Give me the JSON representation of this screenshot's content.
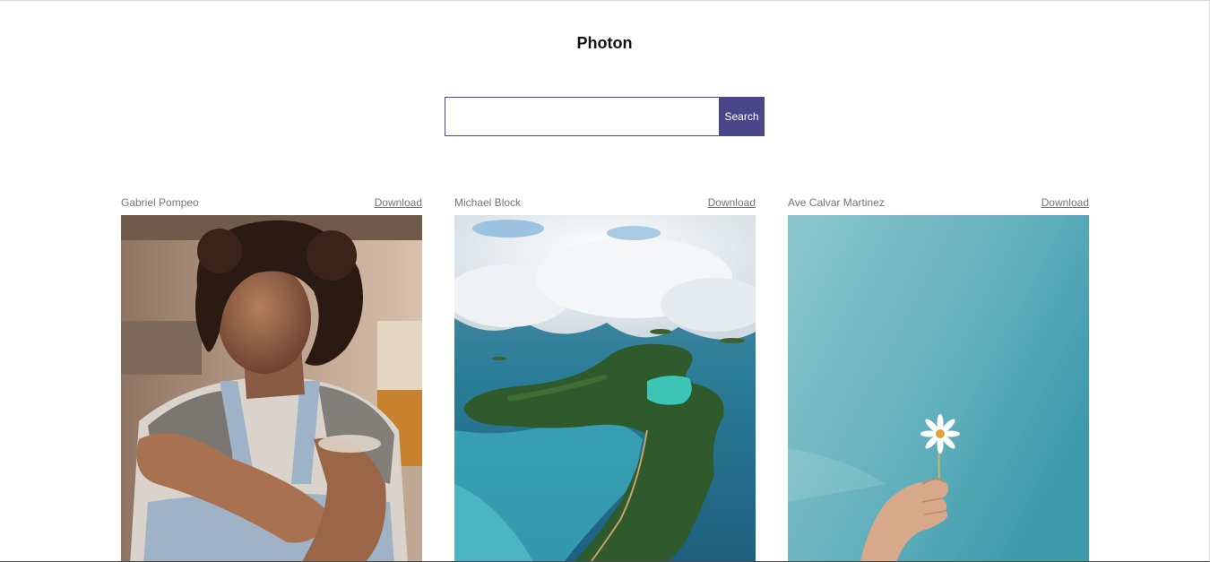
{
  "header": {
    "title": "Photon"
  },
  "search": {
    "value": "",
    "placeholder": "",
    "button_label": "Search"
  },
  "photos": [
    {
      "author": "Gabriel Pompeo",
      "download_label": "Download",
      "subject": "portrait of a woman with curly hair in a denim overall"
    },
    {
      "author": "Michael Block",
      "download_label": "Download",
      "subject": "aerial view of a green island with a turquoise lagoon"
    },
    {
      "author": "Ave Calvar Martinez",
      "download_label": "Download",
      "subject": "hand holding a small daisy against a blue sky"
    }
  ],
  "colors": {
    "accent": "#4b4589",
    "meta_text": "#757575"
  }
}
